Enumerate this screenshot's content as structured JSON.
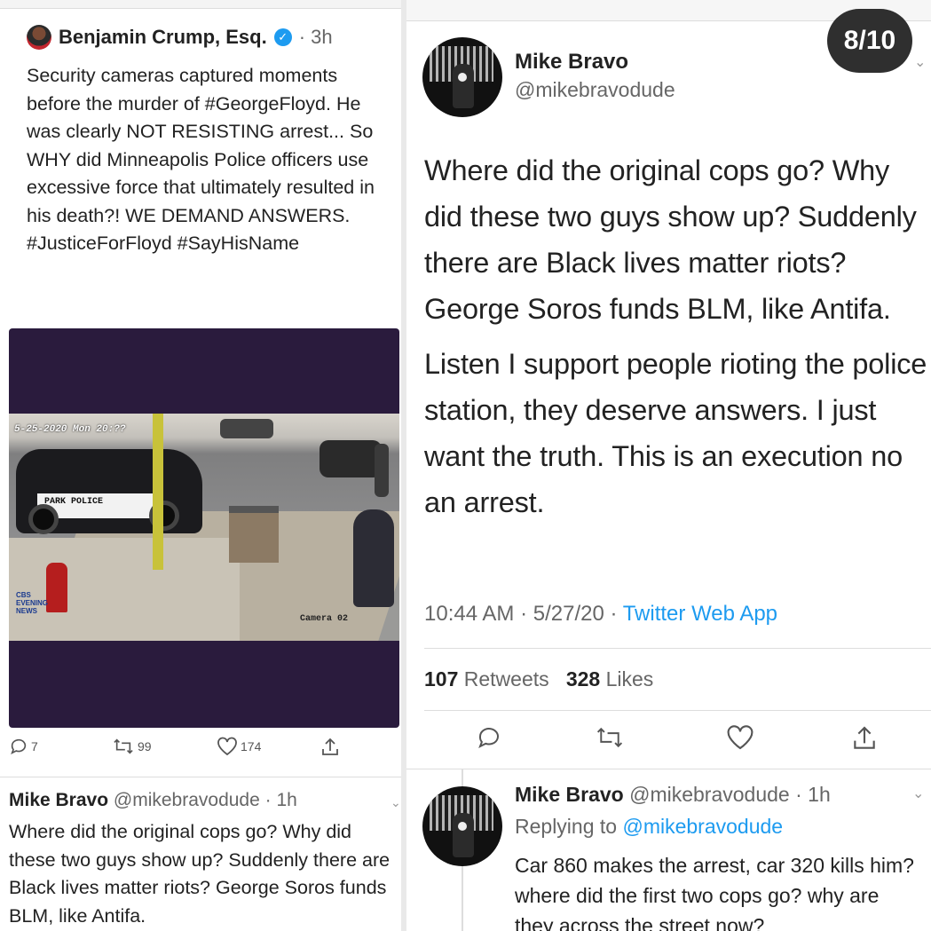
{
  "left": {
    "author": {
      "name": "Benjamin Crump, Esq.",
      "verified_glyph": "✓",
      "time": "· 3h"
    },
    "tweet_text": "Security cameras captured moments before the murder of #GeorgeFloyd. He was clearly NOT RESISTING arrest... So WHY did Minneapolis Police officers use excessive force that ultimately resulted in his death?! WE DEMAND ANSWERS. #JusticeForFloyd #SayHisName",
    "video": {
      "timestamp": "5-25-2020 Mon 20:??",
      "car_label": "PARK POLICE",
      "camera_label": "Camera 02",
      "watermark": "CBS EVENING NEWS"
    },
    "actions": {
      "replies": "7",
      "retweets": "99",
      "likes": "174"
    },
    "reply": {
      "name": "Mike Bravo",
      "handle_time": "@mikebravodude · 1h",
      "text": "Where did the original cops go? Why did these two guys show up? Suddenly there are Black lives matter riots? George Soros funds BLM, like Antifa."
    }
  },
  "right": {
    "counter": "8/10",
    "author": {
      "name": "Mike Bravo",
      "handle": "@mikebravodude"
    },
    "paragraph1": "Where did the original cops go? Why did these two guys show up? Suddenly there are Black lives matter riots? George Soros funds BLM, like Antifa.",
    "paragraph2": "Listen I support people rioting the police station, they deserve answers. I just want the truth. This is an execution no an arrest.",
    "meta": {
      "time": "10:44 AM",
      "date": "5/27/20",
      "source": "Twitter Web App"
    },
    "stats": {
      "retweets_count": "107",
      "retweets_label": "Retweets",
      "likes_count": "328",
      "likes_label": "Likes"
    },
    "reply": {
      "name": "Mike Bravo",
      "handle_time": "@mikebravodude · 1h",
      "replying_prefix": "Replying to",
      "replying_handle": "@mikebravodude",
      "text": "Car 860 makes the arrest, car 320 kills him? where did the first two cops go? why are they across the street now?"
    }
  },
  "icons": {
    "reply": "reply-icon",
    "retweet": "retweet-icon",
    "like": "heart-icon",
    "share": "share-icon",
    "chevron": "chevron-down-icon",
    "verified": "verified-badge-icon"
  },
  "colors": {
    "link": "#1d9bf0",
    "video_bg": "#2a1b3d",
    "counter_bg": "#2f2f2f"
  }
}
